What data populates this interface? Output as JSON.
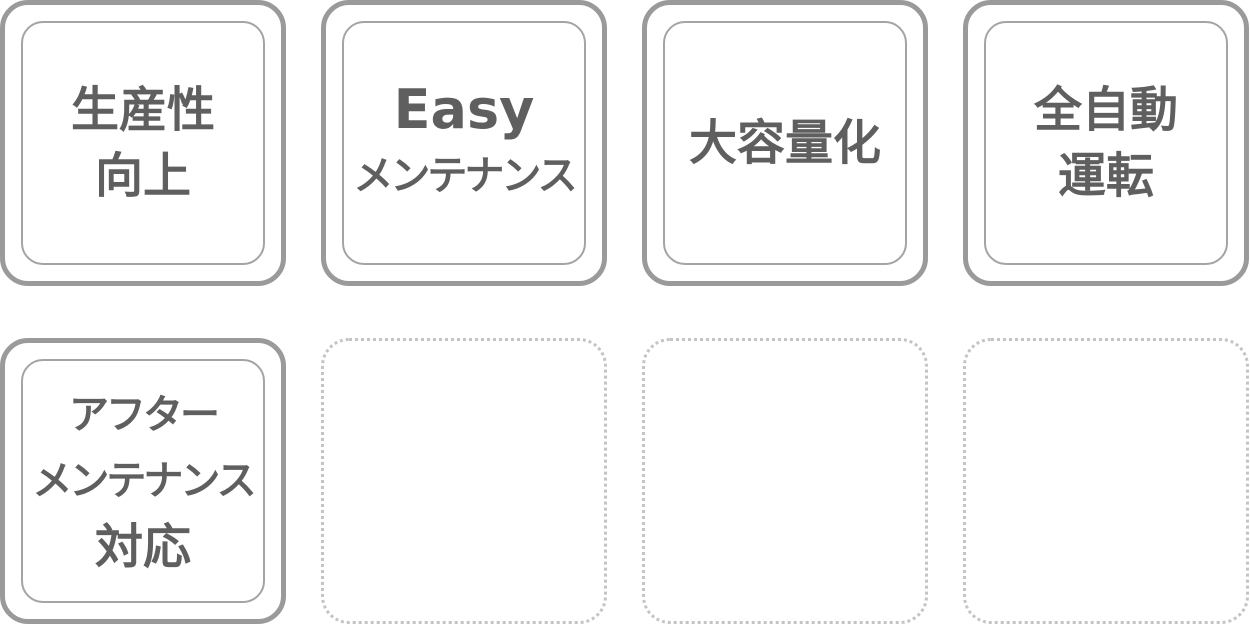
{
  "tiles": [
    {
      "lines": [
        "生産性",
        "向上"
      ]
    },
    {
      "lines": [
        "Easy",
        "メンテナンス"
      ]
    },
    {
      "lines": [
        "大容量化"
      ]
    },
    {
      "lines": [
        "全自動",
        "運転"
      ]
    },
    {
      "lines": [
        "アフター",
        "メンテナンス",
        "対応"
      ]
    }
  ],
  "colors": {
    "tile_border": "#9a9a9a",
    "inner_border": "#a4a4a4",
    "text": "#5f5f5f",
    "empty_border": "#c4c4c4"
  }
}
